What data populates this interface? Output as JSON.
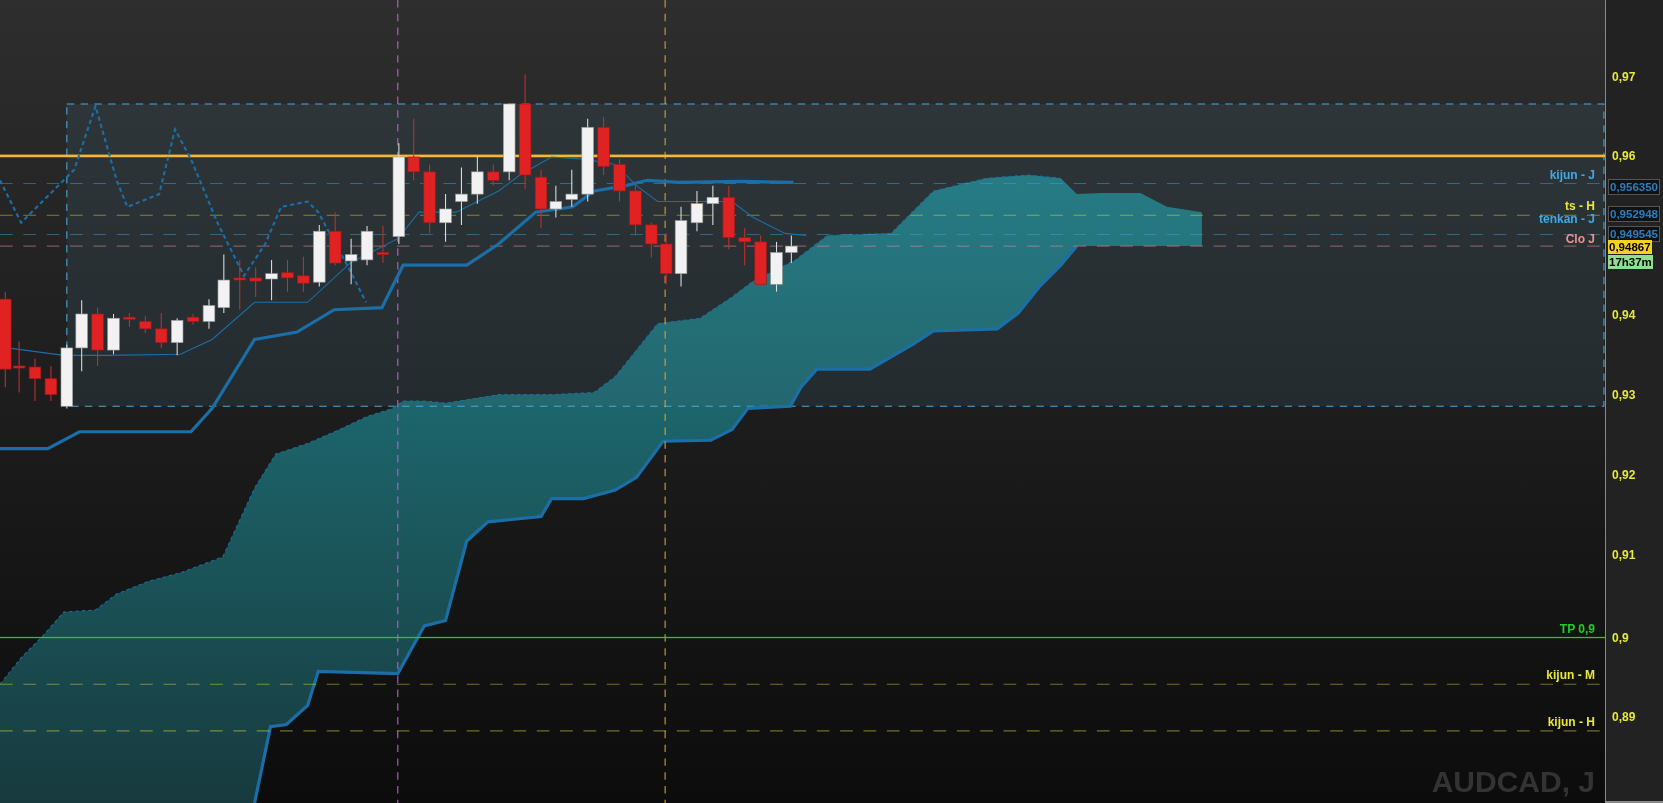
{
  "chart": {
    "symbol_label": "AUDCAD, J",
    "price_axis": {
      "ticks": [
        "0,97",
        "0,96",
        "0,94",
        "0,93",
        "0,92",
        "0,91",
        "0,9",
        "0,89"
      ]
    },
    "level_lines": [
      {
        "color": "#f7b733",
        "kind": "solid"
      },
      {
        "label": "kijun - J",
        "color": "#3fa9e8",
        "kind": "dashed"
      },
      {
        "label": "ts - H",
        "color": "#e8e83a",
        "kind": "dashed"
      },
      {
        "label": "tenkan - J",
        "color": "#3fa9e8",
        "kind": "dashed"
      },
      {
        "label": "Clo J",
        "color": "#f09090",
        "kind": "dashed"
      },
      {
        "label": "TP 0,9",
        "color": "#22cc22",
        "kind": "solid"
      },
      {
        "label": "kijun - M",
        "color": "#e8e83a",
        "kind": "dashed"
      },
      {
        "label": "kijun - H",
        "color": "#e8e83a",
        "kind": "dashed"
      }
    ],
    "price_tags": [
      {
        "text": "0,956350",
        "kind": "line-value"
      },
      {
        "text": "0,952948",
        "kind": "line-value"
      },
      {
        "text": "0,949545",
        "kind": "line-value"
      },
      {
        "text": "0,94867",
        "kind": "current-price"
      },
      {
        "text": "17h37m",
        "kind": "countdown"
      }
    ]
  }
}
